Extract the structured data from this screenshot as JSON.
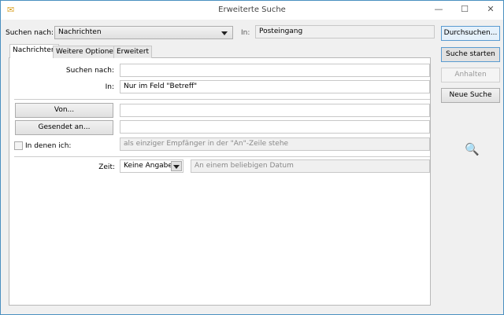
{
  "window": {
    "title": "Erweiterte Suche",
    "minimize": "—",
    "maximize": "☐",
    "close": "✕"
  },
  "top": {
    "search_for_label": "Suchen nach:",
    "search_for_value": "Nachrichten",
    "in_label": "In:",
    "in_value": "Posteingang"
  },
  "buttons": {
    "browse": "Durchsuchen...",
    "start": "Suche starten",
    "stop": "Anhalten",
    "new": "Neue Suche"
  },
  "tabs": [
    {
      "label": "Nachrichten",
      "active": true
    },
    {
      "label": "Weitere Optionen"
    },
    {
      "label": "Erweitert"
    }
  ],
  "form": {
    "search_label": "Suchen nach:",
    "search_value": "",
    "in_label": "In:",
    "in_value": "Nur im Feld \"Betreff\"",
    "from_button": "Von...",
    "from_value": "",
    "sent_to_button": "Gesendet an...",
    "sent_to_value": "",
    "where_i_label": "In denen ich:",
    "where_i_value": "als einziger Empfänger in der \"An\"-Zeile stehe",
    "time_label": "Zeit:",
    "time_value": "Keine Angabe",
    "date_value": "An einem beliebigen Datum"
  }
}
